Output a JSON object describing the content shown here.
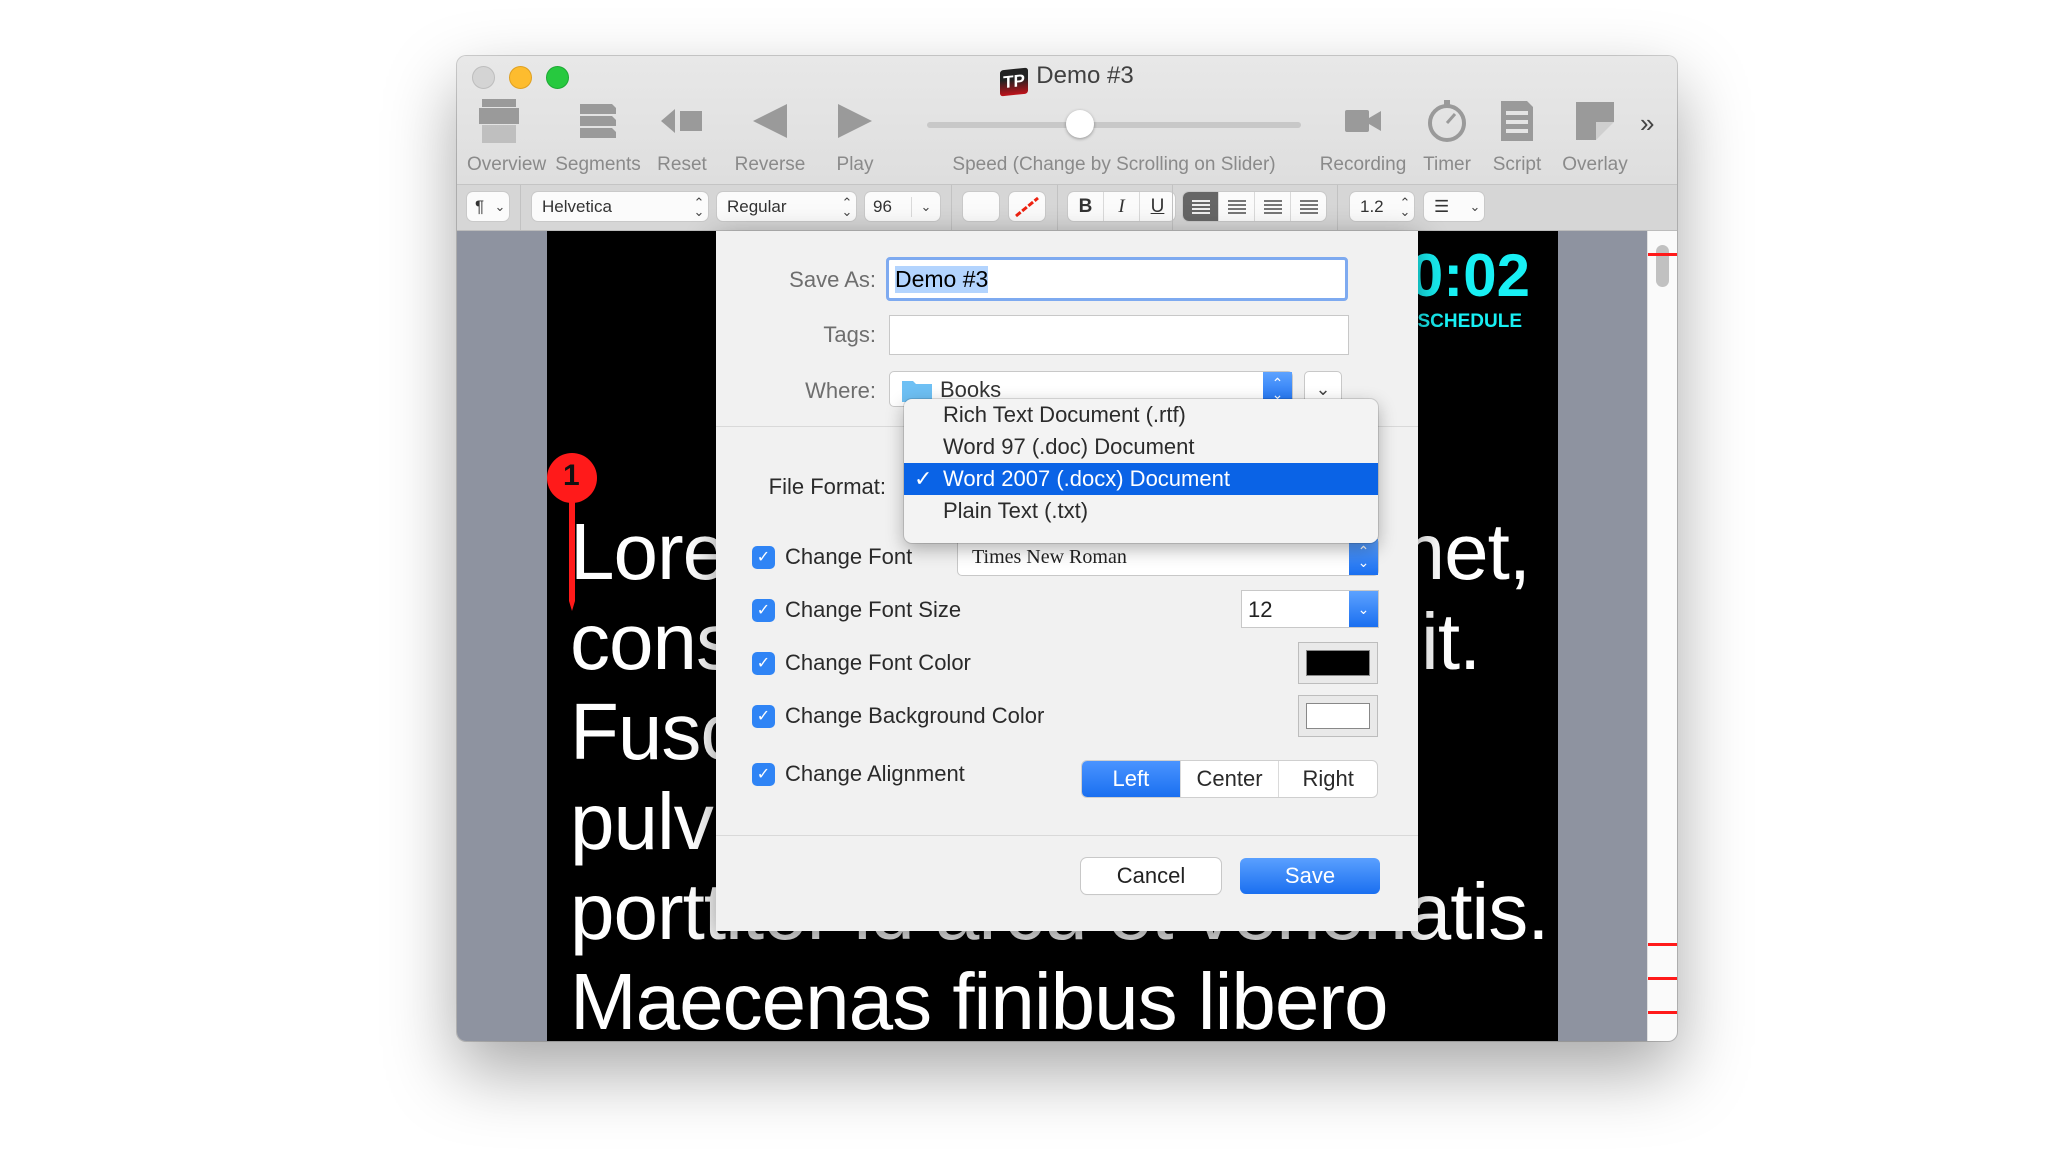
{
  "window": {
    "title": "Demo #3",
    "app_logo_text": "TP"
  },
  "toolbar": {
    "items": [
      {
        "label": "Overview",
        "icon": "overview-icon"
      },
      {
        "label": "Segments",
        "icon": "segments-icon"
      },
      {
        "label": "Reset",
        "icon": "reset-icon"
      },
      {
        "label": "Reverse",
        "icon": "reverse-icon"
      },
      {
        "label": "Play",
        "icon": "play-icon"
      },
      {
        "label": "Speed (Change by Scrolling on Slider)",
        "icon": "speed-slider"
      },
      {
        "label": "Recording",
        "icon": "video-camera-icon"
      },
      {
        "label": "Timer",
        "icon": "stopwatch-icon"
      },
      {
        "label": "Script",
        "icon": "document-icon"
      },
      {
        "label": "Overlay",
        "icon": "overlay-icon"
      }
    ],
    "more_glyph": "»",
    "speed_fraction": 0.41
  },
  "formatbar": {
    "paragraph_glyph": "¶",
    "font_family": "Helvetica",
    "font_style": "Regular",
    "font_size": "96",
    "bold": "B",
    "italic": "I",
    "underline": "U",
    "active_alignment": "left",
    "line_spacing": "1.2",
    "list_glyph": "☰"
  },
  "prompter": {
    "lines": [
      "Lorem ipsum dolor sit amet,",
      "consectetur adipiscing elit.",
      "Fusce convallis dolor",
      "pulvinar",
      "porttitor id arcu et venenatis.",
      "Maecenas finibus libero"
    ],
    "timer": "0:02",
    "schedule": "F SCHEDULE",
    "marker_number": "1",
    "colors": {
      "timer": "#18f0f4",
      "marker": "#ff1a1a"
    }
  },
  "dialog": {
    "save_as_label": "Save As:",
    "save_as_value": "Demo #3",
    "tags_label": "Tags:",
    "tags_value": "",
    "where_label": "Where:",
    "where_value": "Books",
    "file_format_label": "File Format:",
    "file_format_options": [
      {
        "label": "Rich Text Document (.rtf)",
        "selected": false
      },
      {
        "label": "Word 97 (.doc) Document",
        "selected": false
      },
      {
        "label": "Word 2007 (.docx) Document",
        "selected": true
      },
      {
        "label": "Plain Text (.txt)",
        "selected": false
      }
    ],
    "check_glyph": "✓",
    "options": {
      "change_font": {
        "label": "Change Font",
        "checked": true,
        "value": "Times New Roman"
      },
      "change_font_size": {
        "label": "Change Font Size",
        "checked": true,
        "value": "12"
      },
      "change_font_color": {
        "label": "Change Font Color",
        "checked": true,
        "value": "#000000"
      },
      "change_background_color": {
        "label": "Change Background Color",
        "checked": true,
        "value": "#ffffff"
      },
      "change_alignment": {
        "label": "Change Alignment",
        "checked": true,
        "choices": [
          "Left",
          "Center",
          "Right"
        ],
        "selected": "Left"
      }
    },
    "cancel_label": "Cancel",
    "save_label": "Save",
    "accent": "#1a6ff0"
  }
}
